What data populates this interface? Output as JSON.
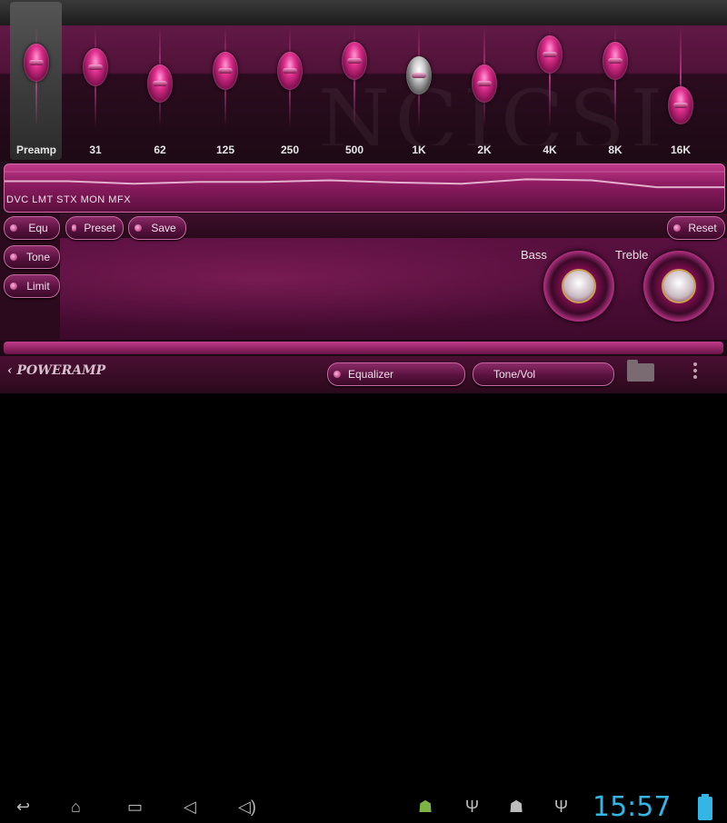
{
  "eq": {
    "watermark": "NCICSI",
    "bands": [
      {
        "label": "Preamp",
        "level": 0.2
      },
      {
        "label": "31",
        "level": 0.25
      },
      {
        "label": "62",
        "level": 0.45
      },
      {
        "label": "125",
        "level": 0.3
      },
      {
        "label": "250",
        "level": 0.3
      },
      {
        "label": "500",
        "level": 0.18
      },
      {
        "label": "1K",
        "level": 0.35
      },
      {
        "label": "2K",
        "level": 0.45
      },
      {
        "label": "4K",
        "level": 0.1
      },
      {
        "label": "8K",
        "level": 0.18
      },
      {
        "label": "16K",
        "level": 0.72
      }
    ],
    "active_band": "1K"
  },
  "curve": {
    "flags": "DVC LMT STX MON MFX"
  },
  "controls": {
    "equ": "Equ",
    "preset": "Preset",
    "save": "Save",
    "reset": "Reset",
    "tone": "Tone",
    "limit": "Limit",
    "bass": "Bass",
    "treble": "Treble"
  },
  "footer": {
    "logo": "POWERAMP",
    "equalizer": "Equalizer",
    "tonevol": "Tone/Vol"
  },
  "status": {
    "time": "15:57"
  },
  "colors": {
    "accent": "#c23a8a",
    "clock": "#33b5e5"
  }
}
